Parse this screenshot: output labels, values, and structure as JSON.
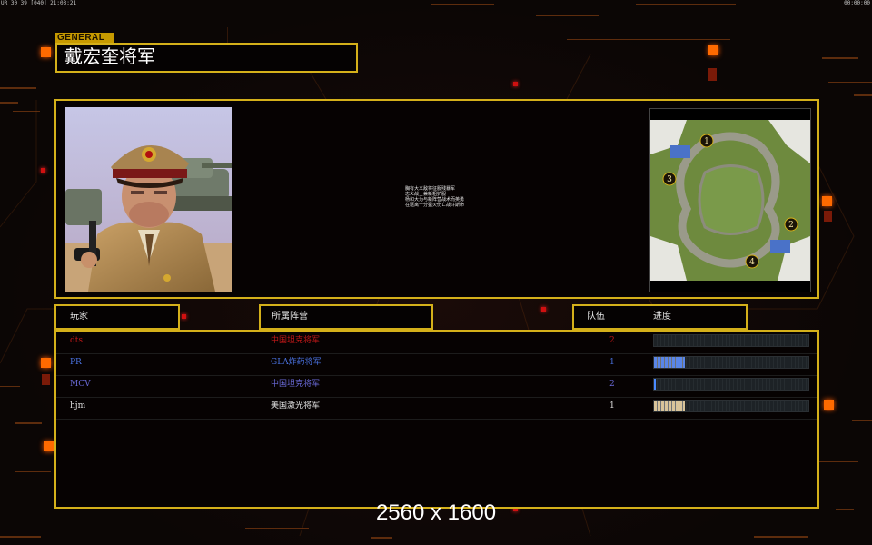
{
  "status_bar": {
    "left": "UR 30 39 [040] 21:03:21",
    "right": "00:00:00"
  },
  "general_tag": "GENERAL",
  "general_name": "戴宏奎将军",
  "briefing_text": "胸有大义敌将征服残暴军\n忠义战士兼新粗犷服\n杨和大为与新阵营战术而英勇\n在驱离十分猛火伤亡战斗斯命",
  "headers": {
    "player": "玩家",
    "faction": "所属阵营",
    "team": "队伍",
    "progress": "进度"
  },
  "players": [
    {
      "name": "dts",
      "faction": "中国坦克将军",
      "team": "2",
      "color": "#c01818",
      "progress": 0,
      "bar_color": "#c01818"
    },
    {
      "name": "PR",
      "faction": "GLA炸药将军",
      "team": "1",
      "color": "#4a72e0",
      "progress": 0.2,
      "bar_color": "#5a86e8"
    },
    {
      "name": "MCV",
      "faction": "中国坦克将军",
      "team": "2",
      "color": "#6a6ad8",
      "progress": 0.01,
      "bar_color": "#4a8aff"
    },
    {
      "name": "hjm",
      "faction": "美国激光将军",
      "team": "1",
      "color": "#e0e0e0",
      "progress": 0.2,
      "bar_color": "#d8c49a"
    }
  ],
  "map_markers": [
    "1",
    "2",
    "3",
    "4"
  ],
  "resolution_label": "2560 x 1600",
  "colors": {
    "frame": "#d4b01a",
    "accent_orange": "#ff6a00"
  }
}
